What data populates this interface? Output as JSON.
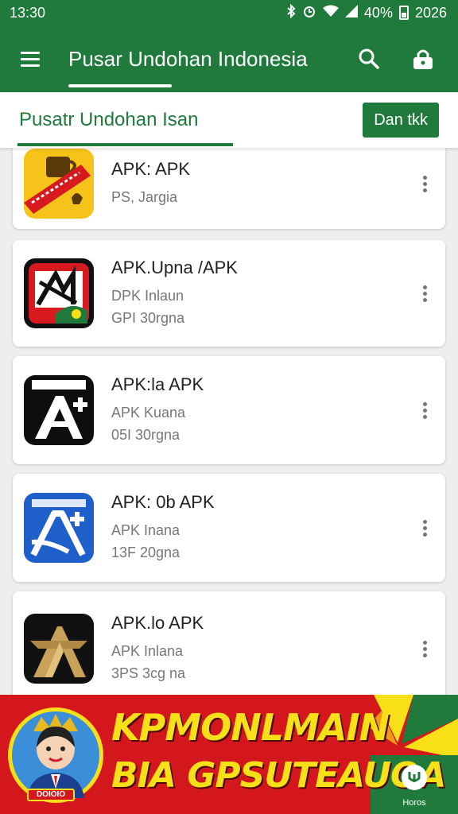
{
  "status_bar": {
    "time": "13:30",
    "battery": "40%",
    "right_time": "2026",
    "icons": [
      "bluetooth-icon",
      "alarm-icon",
      "wifi-icon",
      "signal-icon",
      "battery-icon"
    ]
  },
  "app_bar": {
    "title": "Pusar Undohan Indonesia",
    "icons": [
      "menu-icon",
      "search-icon",
      "lock-icon"
    ]
  },
  "sub_bar": {
    "tab_label": "Pusatr Undohan Isan",
    "button_label": "Dan tkk"
  },
  "apps": [
    {
      "title": "APK: APK",
      "lines": [
        "PS, Jargia"
      ],
      "icon": "yellow-mug-icon"
    },
    {
      "title": "APK.Upna /APK",
      "lines": [
        "DPK Inlaun",
        "GPI 30rgna"
      ],
      "icon": "red-black-badge-icon"
    },
    {
      "title": "APK:la APK",
      "lines": [
        "APK Kuana",
        "05I 30rgna"
      ],
      "icon": "black-a-plus-icon"
    },
    {
      "title": "APK: 0b APK",
      "lines": [
        "APK Inana",
        "13F 20gna"
      ],
      "icon": "blue-a-plus-icon"
    },
    {
      "title": "APK.lo APK",
      "lines": [
        "APK Inlana",
        "3PS 3cg na"
      ],
      "icon": "gold-a-icon"
    }
  ],
  "banner": {
    "line1": "KPMONLMAIN",
    "line2": "BIA GPSUTEAUOA",
    "badge": "DOIOIO",
    "side_label": "Horos"
  },
  "colors": {
    "primary": "#1f7a3c",
    "banner_red": "#d3171c",
    "banner_yellow": "#f7e017"
  }
}
